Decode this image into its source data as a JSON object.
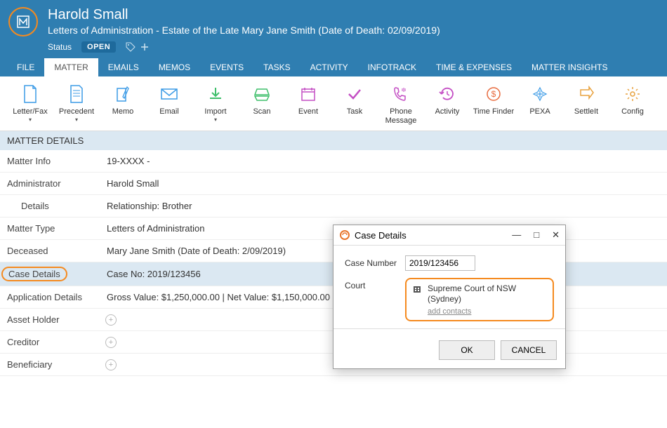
{
  "header": {
    "client_name": "Harold Small",
    "matter_desc": "Letters of Administration - Estate of the Late Mary Jane Smith (Date of Death: 02/09/2019)",
    "status_label": "Status",
    "status_value": "OPEN"
  },
  "menu": [
    "FILE",
    "MATTER",
    "EMAILS",
    "MEMOS",
    "EVENTS",
    "TASKS",
    "ACTIVITY",
    "INFOTRACK",
    "TIME & EXPENSES",
    "MATTER INSIGHTS"
  ],
  "ribbon": [
    {
      "label": "Letter/Fax",
      "caret": true,
      "color": "#3c9be6"
    },
    {
      "label": "Precedent",
      "caret": true,
      "color": "#3c9be6"
    },
    {
      "label": "Memo",
      "caret": false,
      "color": "#3c9be6"
    },
    {
      "label": "Email",
      "caret": false,
      "color": "#3c9be6"
    },
    {
      "label": "Import",
      "caret": true,
      "color": "#3fbf6b"
    },
    {
      "label": "Scan",
      "caret": false,
      "color": "#3fbf6b"
    },
    {
      "label": "Event",
      "caret": false,
      "color": "#c44fc4"
    },
    {
      "label": "Task",
      "caret": false,
      "color": "#c44fc4"
    },
    {
      "label": "Phone Message",
      "caret": false,
      "color": "#c44fc4"
    },
    {
      "label": "Activity",
      "caret": false,
      "color": "#c44fc4"
    },
    {
      "label": "Time Finder",
      "caret": false,
      "color": "#e86b3e"
    },
    {
      "label": "PEXA",
      "caret": false,
      "color": "#3c9be6"
    },
    {
      "label": "SettleIt",
      "caret": false,
      "color": "#e8a23e"
    },
    {
      "label": "Config",
      "caret": false,
      "color": "#e8a23e"
    }
  ],
  "section_title": "MATTER DETAILS",
  "rows": {
    "matter_info": {
      "label": "Matter Info",
      "value": "19-XXXX -"
    },
    "administrator": {
      "label": "Administrator",
      "value": "Harold Small"
    },
    "details": {
      "label": "Details",
      "value": "Relationship: Brother"
    },
    "matter_type": {
      "label": "Matter Type",
      "value": "Letters of Administration"
    },
    "deceased": {
      "label": "Deceased",
      "value": "Mary Jane Smith (Date of Death: 2/09/2019)"
    },
    "case_details": {
      "label": "Case Details",
      "value": "Case No: 2019/123456"
    },
    "app_details": {
      "label": "Application Details",
      "value": "Gross Value: $1,250,000.00 | Net Value: $1,150,000.00"
    },
    "asset_holder": {
      "label": "Asset Holder"
    },
    "creditor": {
      "label": "Creditor"
    },
    "beneficiary": {
      "label": "Beneficiary"
    }
  },
  "dialog": {
    "title": "Case Details",
    "case_number_label": "Case Number",
    "case_number": "2019/123456",
    "court_label": "Court",
    "court_name": "Supreme Court of NSW (Sydney)",
    "add_contacts": "add contacts",
    "ok": "OK",
    "cancel": "CANCEL"
  }
}
